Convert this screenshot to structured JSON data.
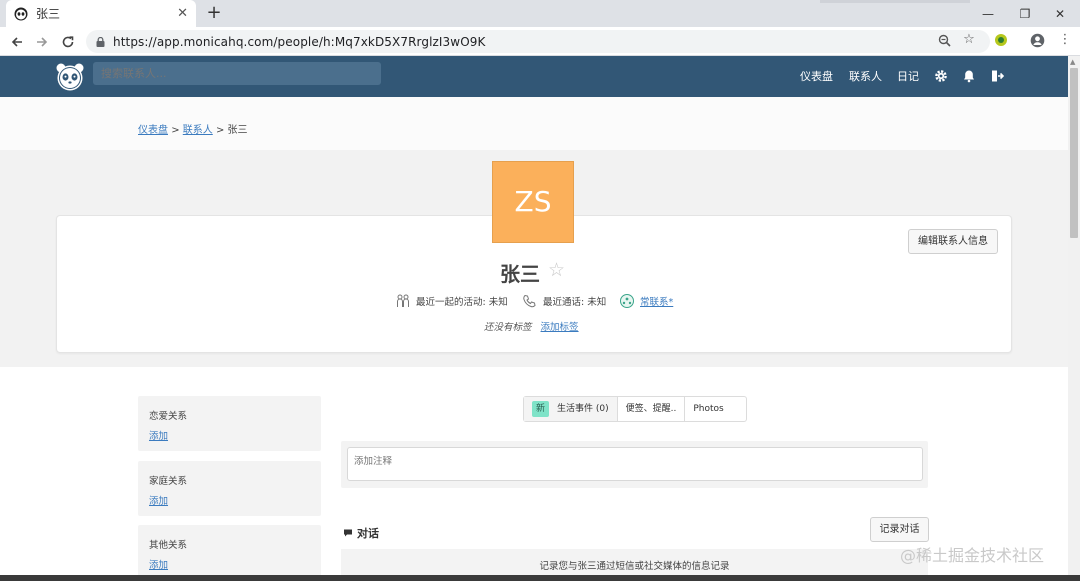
{
  "browser": {
    "tab_title": "张三",
    "tab_close": "✕",
    "new_tab": "+",
    "url": "https://app.monicahq.com/people/h:Mq7xkD5X7RrglzI3wO9K",
    "win_minimize": "—",
    "win_restore": "❐",
    "win_close": "✕"
  },
  "header": {
    "search_placeholder": "搜索联系人...",
    "nav": [
      "仪表盘",
      "联系人",
      "日记"
    ]
  },
  "breadcrumb": {
    "items": [
      "仪表盘",
      "联系人"
    ],
    "separator": ">",
    "current": "张三"
  },
  "profile": {
    "initials": "ZS",
    "avatar_color": "#fbb05b",
    "name": "张三",
    "edit_button": "编辑联系人信息",
    "last_activity": "最近一起的活动: 未知",
    "last_call": "最近通话: 未知",
    "relationship_link": "常联系*",
    "no_tags": "还没有标签",
    "add_tag": "添加标签"
  },
  "sidebar": {
    "boxes": [
      {
        "title": "恋爱关系",
        "action": "添加"
      },
      {
        "title": "家庭关系",
        "action": "添加"
      },
      {
        "title": "其他关系",
        "action": "添加"
      }
    ]
  },
  "tabs": {
    "new_badge": "新",
    "life_events": "生活事件 (0)",
    "notes": "便签、提醒..",
    "photos": "Photos"
  },
  "note": {
    "placeholder": "添加注释"
  },
  "conversations": {
    "title": "对话",
    "log_button": "记录对话",
    "empty_text": "记录您与张三通过短信或社交媒体的信息记录"
  },
  "watermark": "@稀土掘金技术社区",
  "colors": {
    "header_bg": "#325776",
    "link": "#3b7bbf",
    "badge": "#7fe3c8"
  }
}
